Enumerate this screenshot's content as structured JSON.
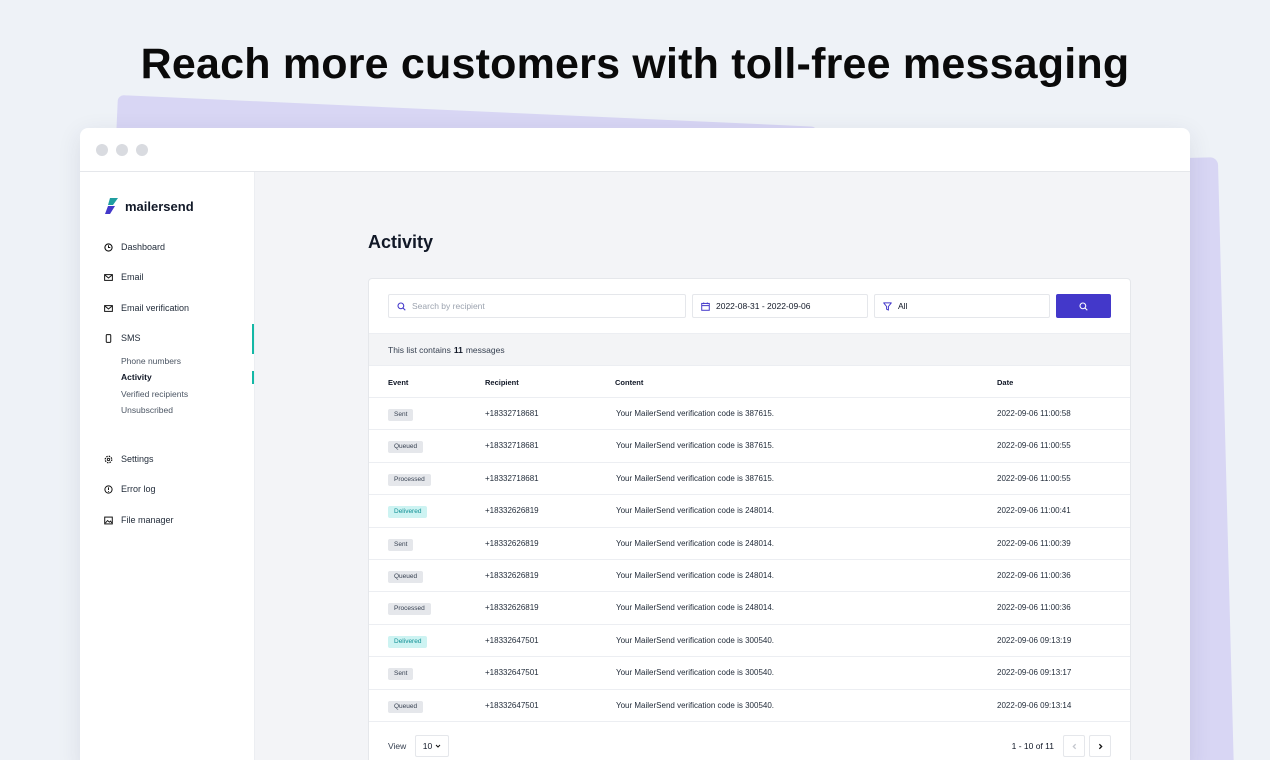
{
  "headline": "Reach more customers with toll-free messaging",
  "brand": {
    "name": "mailersend",
    "accent": "#4338ca",
    "teal": "#14b8a6"
  },
  "sidebar": {
    "items": [
      {
        "label": "Dashboard",
        "icon": "clock-icon"
      },
      {
        "label": "Email",
        "icon": "envelope-icon"
      },
      {
        "label": "Email verification",
        "icon": "envelope-check-icon"
      },
      {
        "label": "SMS",
        "icon": "phone-icon"
      },
      {
        "label": "Settings",
        "icon": "gear-icon"
      },
      {
        "label": "Error log",
        "icon": "alert-circle-icon"
      },
      {
        "label": "File manager",
        "icon": "image-icon"
      }
    ],
    "sms_sub": [
      "Phone numbers",
      "Activity",
      "Verified recipients",
      "Unsubscribed"
    ]
  },
  "page": {
    "title": "Activity"
  },
  "filters": {
    "search_placeholder": "Search by recipient",
    "date_range": "2022-08-31 - 2022-09-06",
    "event_filter": "All"
  },
  "summary": {
    "prefix": "This list contains",
    "count": "11",
    "suffix": "messages"
  },
  "table": {
    "headers": [
      "Event",
      "Recipient",
      "Content",
      "Date"
    ],
    "rows": [
      {
        "event": "Sent",
        "recipient": "+18332718681",
        "content": "Your MailerSend verification code is 387615.",
        "date": "2022-09-06 11:00:58"
      },
      {
        "event": "Queued",
        "recipient": "+18332718681",
        "content": "Your MailerSend verification code is 387615.",
        "date": "2022-09-06 11:00:55"
      },
      {
        "event": "Processed",
        "recipient": "+18332718681",
        "content": "Your MailerSend verification code is 387615.",
        "date": "2022-09-06 11:00:55"
      },
      {
        "event": "Delivered",
        "recipient": "+18332626819",
        "content": "Your MailerSend verification code is 248014.",
        "date": "2022-09-06 11:00:41"
      },
      {
        "event": "Sent",
        "recipient": "+18332626819",
        "content": "Your MailerSend verification code is 248014.",
        "date": "2022-09-06 11:00:39"
      },
      {
        "event": "Queued",
        "recipient": "+18332626819",
        "content": "Your MailerSend verification code is 248014.",
        "date": "2022-09-06 11:00:36"
      },
      {
        "event": "Processed",
        "recipient": "+18332626819",
        "content": "Your MailerSend verification code is 248014.",
        "date": "2022-09-06 11:00:36"
      },
      {
        "event": "Delivered",
        "recipient": "+18332647501",
        "content": "Your MailerSend verification code is 300540.",
        "date": "2022-09-06 09:13:19"
      },
      {
        "event": "Sent",
        "recipient": "+18332647501",
        "content": "Your MailerSend verification code is 300540.",
        "date": "2022-09-06 09:13:17"
      },
      {
        "event": "Queued",
        "recipient": "+18332647501",
        "content": "Your MailerSend verification code is 300540.",
        "date": "2022-09-06 09:13:14"
      }
    ]
  },
  "footer": {
    "view_label": "View",
    "page_size": "10",
    "page_info": "1 - 10 of 11"
  }
}
